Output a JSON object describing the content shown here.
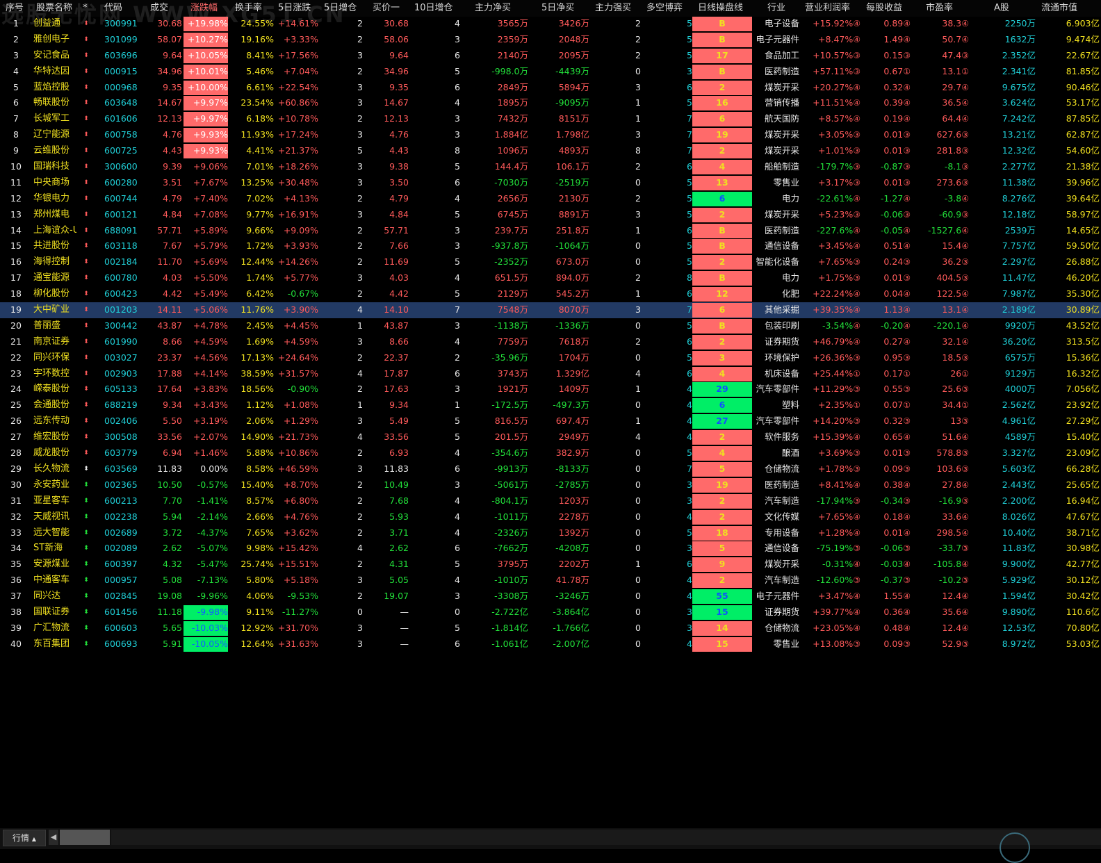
{
  "watermark": "选股无忧网 WWW.XG51.CN",
  "headers": [
    {
      "key": "seq",
      "label": "序号"
    },
    {
      "key": "name",
      "label": "股票名称"
    },
    {
      "key": "star",
      "label": "*"
    },
    {
      "key": "code",
      "label": "代码"
    },
    {
      "key": "price",
      "label": "成交"
    },
    {
      "key": "chg",
      "label": "涨跌幅"
    },
    {
      "key": "turn",
      "label": "换手率"
    },
    {
      "key": "chg5",
      "label": "5日涨跌"
    },
    {
      "key": "add5",
      "label": "5日增仓"
    },
    {
      "key": "bid",
      "label": "买价一"
    },
    {
      "key": "add10",
      "label": "10日增仓"
    },
    {
      "key": "net",
      "label": "主力净买"
    },
    {
      "key": "net5",
      "label": "5日净买"
    },
    {
      "key": "strong",
      "label": "主力强买"
    },
    {
      "key": "ls",
      "label": "多空博弈"
    },
    {
      "key": "line",
      "label": "日线操盘线"
    },
    {
      "key": "ind",
      "label": "行业"
    },
    {
      "key": "margin",
      "label": "营业利润率"
    },
    {
      "key": "eps",
      "label": "每股收益"
    },
    {
      "key": "pe",
      "label": "市盈率"
    },
    {
      "key": "ashare",
      "label": "A股"
    },
    {
      "key": "float",
      "label": "流通市值"
    }
  ],
  "colors": {
    "up": "#ff5a5a",
    "down": "#22e03a",
    "up_box": "#ff6a6a",
    "down_box": "#00ee66",
    "selected_row": "#223a64"
  },
  "rows": [
    [
      "1",
      "创益通",
      "⬍",
      "300991",
      "30.68",
      "+19.98%",
      "24.55%",
      "+14.61%",
      "2",
      "30.68",
      "4",
      "3565万",
      "3426万",
      "2",
      "5",
      "B",
      "电子设备",
      "+15.92%",
      "④",
      "0.89",
      "④",
      "38.3",
      "④",
      "2250万",
      "6.903亿"
    ],
    [
      "2",
      "雅创电子",
      "⬍",
      "301099",
      "58.07",
      "+10.27%",
      "19.16%",
      "+3.33%",
      "2",
      "58.06",
      "3",
      "2359万",
      "2048万",
      "2",
      "5",
      "B",
      "电子元器件",
      "+8.47%",
      "④",
      "1.49",
      "④",
      "50.7",
      "④",
      "1632万",
      "9.474亿"
    ],
    [
      "3",
      "安记食品",
      "⬍",
      "603696",
      "9.64",
      "+10.05%",
      "8.41%",
      "+17.56%",
      "3",
      "9.64",
      "6",
      "2140万",
      "2095万",
      "2",
      "5",
      "17",
      "食品加工",
      "+10.57%",
      "③",
      "0.15",
      "③",
      "47.4",
      "③",
      "2.352亿",
      "22.67亿"
    ],
    [
      "4",
      "华特达因",
      "⬍",
      "000915",
      "34.96",
      "+10.01%",
      "5.46%",
      "+7.04%",
      "2",
      "34.96",
      "5",
      "-998.0万",
      "-4439万",
      "0",
      "3",
      "B",
      "医药制造",
      "+57.11%",
      "③",
      "0.67",
      "①",
      "13.1",
      "①",
      "2.341亿",
      "81.85亿"
    ],
    [
      "5",
      "蓝焰控股",
      "⬍",
      "000968",
      "9.35",
      "+10.00%",
      "6.61%",
      "+22.54%",
      "3",
      "9.35",
      "6",
      "2849万",
      "5894万",
      "3",
      "6",
      "2",
      "煤炭开采",
      "+20.27%",
      "④",
      "0.32",
      "④",
      "29.7",
      "④",
      "9.675亿",
      "90.46亿"
    ],
    [
      "6",
      "畅联股份",
      "⬍",
      "603648",
      "14.67",
      "+9.97%",
      "23.54%",
      "+60.86%",
      "3",
      "14.67",
      "4",
      "1895万",
      "-9095万",
      "1",
      "5",
      "16",
      "营销传播",
      "+11.51%",
      "④",
      "0.39",
      "④",
      "36.5",
      "④",
      "3.624亿",
      "53.17亿"
    ],
    [
      "7",
      "长城军工",
      "⬍",
      "601606",
      "12.13",
      "+9.97%",
      "6.18%",
      "+10.78%",
      "2",
      "12.13",
      "3",
      "7432万",
      "8151万",
      "1",
      "7",
      "6",
      "航天国防",
      "+8.57%",
      "④",
      "0.19",
      "④",
      "64.4",
      "④",
      "7.242亿",
      "87.85亿"
    ],
    [
      "8",
      "辽宁能源",
      "⬍",
      "600758",
      "4.76",
      "+9.93%",
      "11.93%",
      "+17.24%",
      "3",
      "4.76",
      "3",
      "1.884亿",
      "1.798亿",
      "3",
      "7",
      "19",
      "煤炭开采",
      "+3.05%",
      "③",
      "0.01",
      "③",
      "627.6",
      "③",
      "13.21亿",
      "62.87亿"
    ],
    [
      "9",
      "云维股份",
      "⬍",
      "600725",
      "4.43",
      "+9.93%",
      "4.41%",
      "+21.37%",
      "5",
      "4.43",
      "8",
      "1096万",
      "4893万",
      "8",
      "7",
      "2",
      "煤炭开采",
      "+1.01%",
      "③",
      "0.01",
      "③",
      "281.8",
      "③",
      "12.32亿",
      "54.60亿"
    ],
    [
      "10",
      "国瑞科技",
      "⬍",
      "300600",
      "9.39",
      "+9.06%",
      "7.01%",
      "+18.26%",
      "3",
      "9.38",
      "5",
      "144.4万",
      "106.1万",
      "2",
      "6",
      "4",
      "船舶制造",
      "-179.7%",
      "③",
      "-0.87",
      "③",
      "-8.1",
      "③",
      "2.277亿",
      "21.38亿"
    ],
    [
      "11",
      "中央商场",
      "⬍",
      "600280",
      "3.51",
      "+7.67%",
      "13.25%",
      "+30.48%",
      "3",
      "3.50",
      "6",
      "-7030万",
      "-2519万",
      "0",
      "5",
      "13",
      "零售业",
      "+3.17%",
      "③",
      "0.01",
      "③",
      "273.6",
      "③",
      "11.38亿",
      "39.96亿"
    ],
    [
      "12",
      "华银电力",
      "⬍",
      "600744",
      "4.79",
      "+7.40%",
      "7.02%",
      "+4.13%",
      "2",
      "4.79",
      "4",
      "2656万",
      "2130万",
      "2",
      "5",
      "6",
      "电力",
      "-22.61%",
      "④",
      "-1.27",
      "④",
      "-3.8",
      "④",
      "8.276亿",
      "39.64亿"
    ],
    [
      "13",
      "郑州煤电",
      "⬍",
      "600121",
      "4.84",
      "+7.08%",
      "9.77%",
      "+16.91%",
      "3",
      "4.84",
      "5",
      "6745万",
      "8891万",
      "3",
      "5",
      "2",
      "煤炭开采",
      "+5.23%",
      "③",
      "-0.06",
      "③",
      "-60.9",
      "③",
      "12.18亿",
      "58.97亿"
    ],
    [
      "14",
      "上海谊众-U",
      "⬍",
      "688091",
      "57.71",
      "+5.89%",
      "9.66%",
      "+9.09%",
      "2",
      "57.71",
      "3",
      "239.7万",
      "251.8万",
      "1",
      "6",
      "B",
      "医药制造",
      "-227.6%",
      "④",
      "-0.05",
      "④",
      "-1527.6",
      "④",
      "2539万",
      "14.65亿"
    ],
    [
      "15",
      "共进股份",
      "⬍",
      "603118",
      "7.67",
      "+5.79%",
      "1.72%",
      "+3.93%",
      "2",
      "7.66",
      "3",
      "-937.8万",
      "-1064万",
      "0",
      "5",
      "B",
      "通信设备",
      "+3.45%",
      "④",
      "0.51",
      "④",
      "15.4",
      "④",
      "7.757亿",
      "59.50亿"
    ],
    [
      "16",
      "海得控制",
      "⬍",
      "002184",
      "11.70",
      "+5.69%",
      "12.44%",
      "+14.26%",
      "2",
      "11.69",
      "5",
      "-2352万",
      "673.0万",
      "0",
      "5",
      "2",
      "智能化设备",
      "+7.65%",
      "③",
      "0.24",
      "③",
      "36.2",
      "③",
      "2.297亿",
      "26.88亿"
    ],
    [
      "17",
      "通宝能源",
      "⬍",
      "600780",
      "4.03",
      "+5.50%",
      "1.74%",
      "+5.77%",
      "3",
      "4.03",
      "4",
      "651.5万",
      "894.0万",
      "2",
      "8",
      "B",
      "电力",
      "+1.75%",
      "③",
      "0.01",
      "③",
      "404.5",
      "③",
      "11.47亿",
      "46.20亿"
    ],
    [
      "18",
      "柳化股份",
      "⬍",
      "600423",
      "4.42",
      "+5.49%",
      "6.42%",
      "-0.67%",
      "2",
      "4.42",
      "5",
      "2129万",
      "545.2万",
      "1",
      "6",
      "12",
      "化肥",
      "+22.24%",
      "④",
      "0.04",
      "④",
      "122.5",
      "④",
      "7.987亿",
      "35.30亿"
    ],
    [
      "19",
      "大中矿业",
      "⬍",
      "001203",
      "14.11",
      "+5.06%",
      "11.76%",
      "+3.90%",
      "4",
      "14.10",
      "7",
      "7548万",
      "8070万",
      "3",
      "7",
      "6",
      "其他采掘",
      "+39.35%",
      "④",
      "1.13",
      "④",
      "13.1",
      "④",
      "2.189亿",
      "30.89亿"
    ],
    [
      "20",
      "普丽盛",
      "⬍",
      "300442",
      "43.87",
      "+4.78%",
      "2.45%",
      "+4.45%",
      "1",
      "43.87",
      "3",
      "-1138万",
      "-1336万",
      "0",
      "5",
      "B",
      "包装印刷",
      "-3.54%",
      "④",
      "-0.20",
      "④",
      "-220.1",
      "④",
      "9920万",
      "43.52亿"
    ],
    [
      "21",
      "南京证券",
      "⬍",
      "601990",
      "8.66",
      "+4.59%",
      "1.69%",
      "+4.59%",
      "3",
      "8.66",
      "4",
      "7759万",
      "7618万",
      "2",
      "6",
      "2",
      "证券期货",
      "+46.79%",
      "④",
      "0.27",
      "④",
      "32.1",
      "④",
      "36.20亿",
      "313.5亿"
    ],
    [
      "22",
      "同兴环保",
      "⬍",
      "003027",
      "23.37",
      "+4.56%",
      "17.13%",
      "+24.64%",
      "2",
      "22.37",
      "2",
      "-35.96万",
      "1704万",
      "0",
      "5",
      "3",
      "环境保护",
      "+26.36%",
      "③",
      "0.95",
      "③",
      "18.5",
      "③",
      "6575万",
      "15.36亿"
    ],
    [
      "23",
      "宇环数控",
      "⬍",
      "002903",
      "17.88",
      "+4.14%",
      "38.59%",
      "+31.57%",
      "4",
      "17.87",
      "6",
      "3743万",
      "1.329亿",
      "4",
      "6",
      "4",
      "机床设备",
      "+25.44%",
      "①",
      "0.17",
      "①",
      "26",
      "①",
      "9129万",
      "16.32亿"
    ],
    [
      "24",
      "嵘泰股份",
      "⬍",
      "605133",
      "17.64",
      "+3.83%",
      "18.56%",
      "-0.90%",
      "2",
      "17.63",
      "3",
      "1921万",
      "1409万",
      "1",
      "4",
      "29",
      "汽车零部件",
      "+11.29%",
      "③",
      "0.55",
      "③",
      "25.6",
      "③",
      "4000万",
      "7.056亿"
    ],
    [
      "25",
      "会通股份",
      "⬍",
      "688219",
      "9.34",
      "+3.43%",
      "1.12%",
      "+1.08%",
      "1",
      "9.34",
      "1",
      "-172.5万",
      "-497.3万",
      "0",
      "4",
      "6",
      "塑料",
      "+2.35%",
      "①",
      "0.07",
      "①",
      "34.4",
      "①",
      "2.562亿",
      "23.92亿"
    ],
    [
      "26",
      "远东传动",
      "⬍",
      "002406",
      "5.50",
      "+3.19%",
      "2.06%",
      "+1.29%",
      "3",
      "5.49",
      "5",
      "816.5万",
      "697.4万",
      "1",
      "4",
      "27",
      "汽车零部件",
      "+14.20%",
      "③",
      "0.32",
      "③",
      "13",
      "③",
      "4.961亿",
      "27.29亿"
    ],
    [
      "27",
      "维宏股份",
      "⬍",
      "300508",
      "33.56",
      "+2.07%",
      "14.90%",
      "+21.73%",
      "4",
      "33.56",
      "5",
      "201.5万",
      "2949万",
      "4",
      "4",
      "2",
      "软件服务",
      "+15.39%",
      "④",
      "0.65",
      "④",
      "51.6",
      "④",
      "4589万",
      "15.40亿"
    ],
    [
      "28",
      "威龙股份",
      "⬍",
      "603779",
      "6.94",
      "+1.46%",
      "5.88%",
      "+10.86%",
      "2",
      "6.93",
      "4",
      "-354.6万",
      "382.9万",
      "0",
      "5",
      "4",
      "酿酒",
      "+3.69%",
      "③",
      "0.01",
      "③",
      "578.8",
      "③",
      "3.327亿",
      "23.09亿"
    ],
    [
      "29",
      "长久物流",
      "⬍",
      "603569",
      "11.83",
      "0.00%",
      "8.58%",
      "+46.59%",
      "3",
      "11.83",
      "6",
      "-9913万",
      "-8133万",
      "0",
      "7",
      "5",
      "仓储物流",
      "+1.78%",
      "③",
      "0.09",
      "③",
      "103.6",
      "③",
      "5.603亿",
      "66.28亿"
    ],
    [
      "30",
      "永安药业",
      "⬍",
      "002365",
      "10.50",
      "-0.57%",
      "15.40%",
      "+8.70%",
      "2",
      "10.49",
      "3",
      "-5061万",
      "-2785万",
      "0",
      "3",
      "19",
      "医药制造",
      "+8.41%",
      "④",
      "0.38",
      "④",
      "27.8",
      "④",
      "2.443亿",
      "25.65亿"
    ],
    [
      "31",
      "亚星客车",
      "⬍",
      "600213",
      "7.70",
      "-1.41%",
      "8.57%",
      "+6.80%",
      "2",
      "7.68",
      "4",
      "-804.1万",
      "1203万",
      "0",
      "3",
      "2",
      "汽车制造",
      "-17.94%",
      "③",
      "-0.34",
      "③",
      "-16.9",
      "③",
      "2.200亿",
      "16.94亿"
    ],
    [
      "32",
      "天威视讯",
      "⬍",
      "002238",
      "5.94",
      "-2.14%",
      "2.66%",
      "+4.76%",
      "2",
      "5.93",
      "4",
      "-1011万",
      "2278万",
      "0",
      "4",
      "2",
      "文化传媒",
      "+7.65%",
      "④",
      "0.18",
      "④",
      "33.6",
      "④",
      "8.026亿",
      "47.67亿"
    ],
    [
      "33",
      "远大智能",
      "⬍",
      "002689",
      "3.72",
      "-4.37%",
      "7.65%",
      "+3.62%",
      "2",
      "3.71",
      "4",
      "-2326万",
      "1392万",
      "0",
      "5",
      "18",
      "专用设备",
      "+1.28%",
      "④",
      "0.01",
      "④",
      "298.5",
      "④",
      "10.40亿",
      "38.71亿"
    ],
    [
      "34",
      "ST新海",
      "⬍",
      "002089",
      "2.62",
      "-5.07%",
      "9.98%",
      "+15.42%",
      "4",
      "2.62",
      "6",
      "-7662万",
      "-4208万",
      "0",
      "3",
      "5",
      "通信设备",
      "-75.19%",
      "③",
      "-0.06",
      "③",
      "-33.7",
      "③",
      "11.83亿",
      "30.98亿"
    ],
    [
      "35",
      "安源煤业",
      "⬍",
      "600397",
      "4.32",
      "-5.47%",
      "25.74%",
      "+15.51%",
      "2",
      "4.31",
      "5",
      "3795万",
      "2202万",
      "1",
      "6",
      "9",
      "煤炭开采",
      "-0.31%",
      "④",
      "-0.03",
      "④",
      "-105.8",
      "④",
      "9.900亿",
      "42.77亿"
    ],
    [
      "36",
      "中通客车",
      "⬍",
      "000957",
      "5.08",
      "-7.13%",
      "5.80%",
      "+5.18%",
      "3",
      "5.05",
      "4",
      "-1010万",
      "41.78万",
      "0",
      "4",
      "2",
      "汽车制造",
      "-12.60%",
      "③",
      "-0.37",
      "③",
      "-10.2",
      "③",
      "5.929亿",
      "30.12亿"
    ],
    [
      "37",
      "同兴达",
      "⬍",
      "002845",
      "19.08",
      "-9.96%",
      "4.06%",
      "-9.53%",
      "2",
      "19.07",
      "3",
      "-3308万",
      "-3246万",
      "0",
      "4",
      "55",
      "电子元器件",
      "+3.47%",
      "④",
      "1.55",
      "④",
      "12.4",
      "④",
      "1.594亿",
      "30.42亿"
    ],
    [
      "38",
      "国联证券",
      "⬍",
      "601456",
      "11.18",
      "-9.98%",
      "9.11%",
      "-11.27%",
      "0",
      "—",
      "0",
      "-2.722亿",
      "-3.864亿",
      "0",
      "3",
      "15",
      "证券期货",
      "+39.77%",
      "④",
      "0.36",
      "④",
      "35.6",
      "④",
      "9.890亿",
      "110.6亿"
    ],
    [
      "39",
      "广汇物流",
      "⬍",
      "600603",
      "5.65",
      "-10.03%",
      "12.92%",
      "+31.70%",
      "3",
      "—",
      "5",
      "-1.814亿",
      "-1.766亿",
      "0",
      "3",
      "14",
      "仓储物流",
      "+23.05%",
      "④",
      "0.48",
      "④",
      "12.4",
      "④",
      "12.53亿",
      "70.80亿"
    ],
    [
      "40",
      "东百集团",
      "⬍",
      "600693",
      "5.91",
      "-10.05%",
      "12.64%",
      "+31.63%",
      "3",
      "—",
      "6",
      "-1.061亿",
      "-2.007亿",
      "0",
      "4",
      "15",
      "零售业",
      "+13.08%",
      "③",
      "0.09",
      "③",
      "52.9",
      "③",
      "8.972亿",
      "53.03亿"
    ]
  ],
  "limit_up_rows": [
    1,
    2,
    3,
    4,
    5,
    6,
    7,
    8,
    9
  ],
  "limit_down_rows": [
    38,
    39,
    40
  ],
  "green_line_rows": [
    12,
    24,
    25,
    26,
    37,
    38
  ],
  "selected_row": 19,
  "bottom_tab": {
    "label": "行情",
    "arrow": "▲"
  },
  "scroll_left_arrow": "◀"
}
